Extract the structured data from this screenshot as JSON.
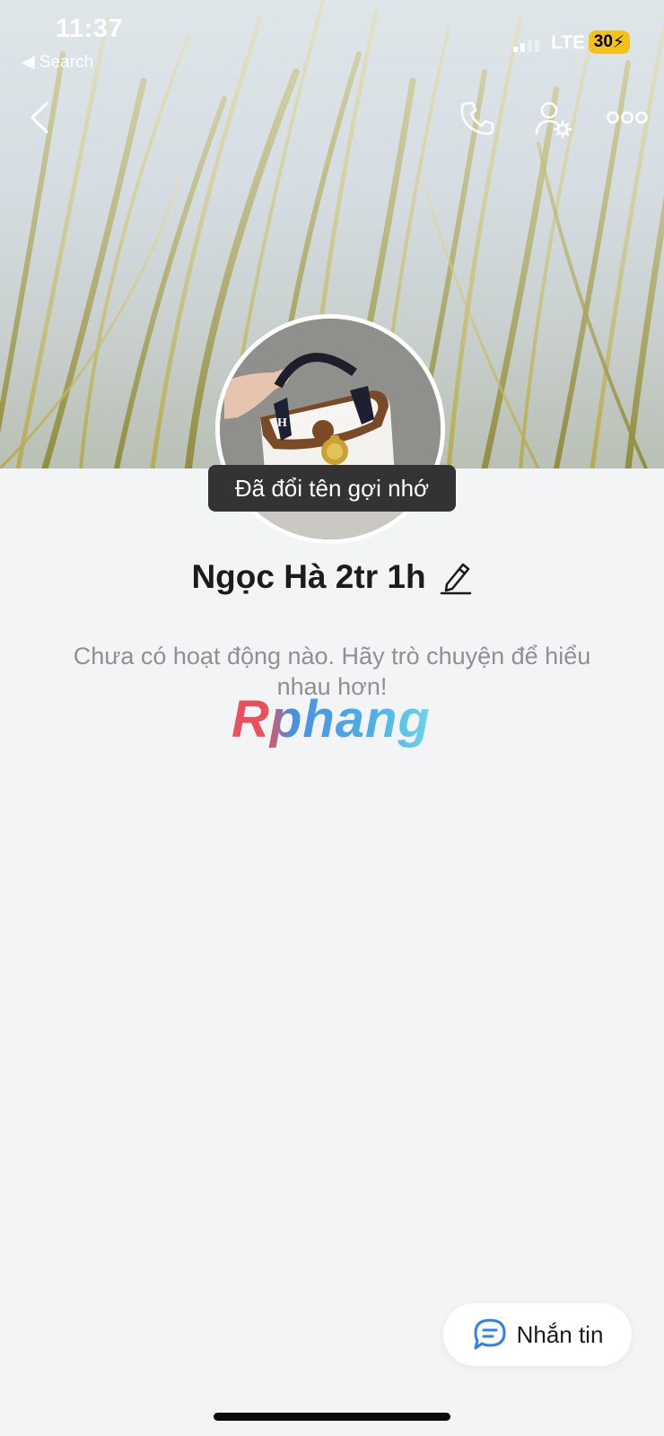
{
  "status_bar": {
    "time": "11:37",
    "back_app": "◀ Search",
    "network": "LTE",
    "battery": "30"
  },
  "header": {
    "icons": [
      "back-icon",
      "phone-icon",
      "user-settings-icon",
      "more-icon"
    ]
  },
  "toast": "Đã đổi tên gợi nhớ",
  "profile": {
    "name": "Ngọc Hà 2tr 1h",
    "empty_message": "Chưa có hoạt động nào. Hãy trò chuyện để hiểu nhau hơn!"
  },
  "watermark": "Rphang",
  "message_button": {
    "label": "Nhắn tin",
    "icon": "chat-bubble-icon"
  },
  "colors": {
    "accent": "#2f80ed",
    "background": "#f3f4f6",
    "toast_bg": "#333336",
    "battery": "#f2c21a"
  }
}
